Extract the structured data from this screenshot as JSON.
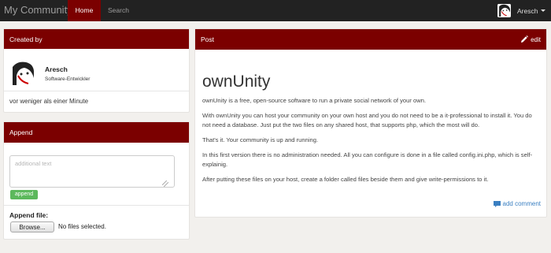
{
  "navbar": {
    "brand": "My Community",
    "home": "Home",
    "search": "Search",
    "username": "Aresch"
  },
  "created_panel": {
    "title": "Created by",
    "author_name": "Aresch",
    "author_role": "Software-Entwickler",
    "time_ago": "vor weniger als einer Minute"
  },
  "append_panel": {
    "title": "Append",
    "placeholder": "additional text",
    "append_button": "append",
    "file_label": "Append file:",
    "browse_button": "Browse...",
    "no_file_text": "No files selected."
  },
  "post_panel": {
    "title": "Post",
    "edit": "edit",
    "post_title": "ownUnity",
    "paragraphs": [
      "ownUnity is a free, open-source software to run a private social network of your own.",
      "With ownUnity you can host your community on your own host and you do not need to be a it-professional to install it. You do not need a database. Just put the two files on any shared host, that supports php, which the most will do.",
      "That's it. Your community is up and running.",
      "In this first version there is no administration needed. All you can configure is done in a file called config.ini.php, which is self-explainig.",
      "After putting these files on your host, create a folder called files beside them and give write-permissions to it."
    ],
    "add_comment": "add comment"
  },
  "colors": {
    "navbar_bg": "#222222",
    "accent": "#7b0000",
    "append_green": "#5cb85c",
    "link_blue": "#3a7fc1"
  },
  "icons": [
    "avatar-face-icon",
    "caret-down-icon",
    "pencil-icon",
    "comment-icon",
    "resize-grip-icon"
  ]
}
